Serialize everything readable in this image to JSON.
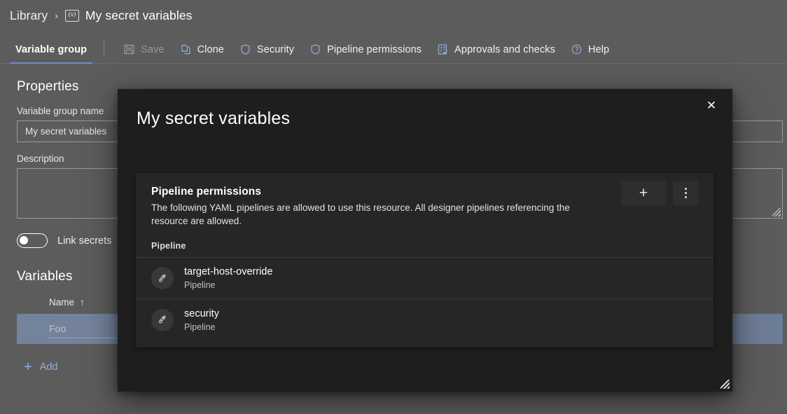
{
  "breadcrumb": {
    "parent": "Library",
    "separator": "›",
    "icon_glyph": "(x)",
    "current": "My secret variables"
  },
  "toolbar": {
    "active_tab": "Variable group",
    "buttons": [
      {
        "label": "Save",
        "icon": "save-icon",
        "disabled": true
      },
      {
        "label": "Clone",
        "icon": "clone-icon",
        "disabled": false
      },
      {
        "label": "Security",
        "icon": "shield-icon",
        "disabled": false
      },
      {
        "label": "Pipeline permissions",
        "icon": "shield-icon",
        "disabled": false
      },
      {
        "label": "Approvals and checks",
        "icon": "checklist-icon",
        "disabled": false
      },
      {
        "label": "Help",
        "icon": "help-circle-icon",
        "disabled": false
      }
    ]
  },
  "properties": {
    "heading": "Properties",
    "name_label": "Variable group name",
    "name_value": "My secret variables",
    "description_label": "Description",
    "description_value": "",
    "link_secrets_label": "Link secrets"
  },
  "variables": {
    "heading": "Variables",
    "column_name": "Name",
    "sort_arrow": "↑",
    "rows": [
      {
        "name": "Foo"
      }
    ],
    "add_label": "Add",
    "add_glyph": "+"
  },
  "modal": {
    "title": "My secret variables",
    "close_glyph": "✕",
    "card": {
      "title": "Pipeline permissions",
      "description": "The following YAML pipelines are allowed to use this resource. All designer pipelines referencing the resource are allowed.",
      "column_header": "Pipeline",
      "add_glyph": "+",
      "rows": [
        {
          "name": "target-host-override",
          "type": "Pipeline",
          "icon": "rocket-icon"
        },
        {
          "name": "security",
          "type": "Pipeline",
          "icon": "rocket-icon"
        }
      ]
    }
  },
  "colors": {
    "page_bg": "#5c5c5c",
    "modal_bg": "#1e1e1e",
    "card_bg": "#262626",
    "accent_blue": "#6b8fc9",
    "link_blue": "#8fb0de",
    "row_selected": "#6e7d96"
  }
}
